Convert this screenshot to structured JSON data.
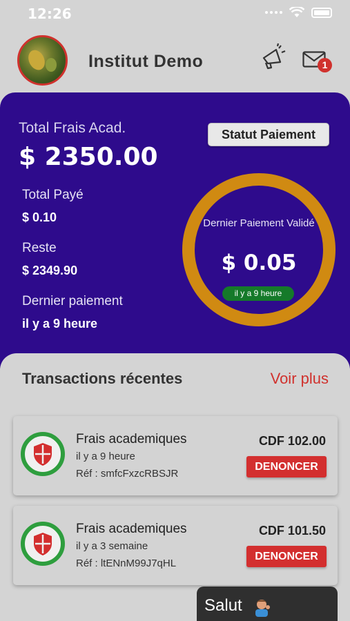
{
  "status_bar": {
    "time": "12:26"
  },
  "header": {
    "institution": "Institut Demo",
    "notification_count": "1",
    "icons": [
      "avatar",
      "megaphone-icon",
      "mail-icon"
    ]
  },
  "summary": {
    "total_label": "Total Frais Acad.",
    "total_value": "$ 2350.00",
    "paid_label": "Total Payé",
    "paid_value": "$ 0.10",
    "rest_label": "Reste",
    "rest_value": "$ 2349.90",
    "last_label": "Dernier paiement",
    "last_value": "il y a 9 heure",
    "status_button": "Statut Paiement",
    "ring_title": "Dernier Paiement Validé",
    "ring_value": "$ 0.05",
    "ring_badge": "il y a 9 heure"
  },
  "transactions": {
    "title": "Transactions récentes",
    "more": "Voir plus",
    "items": [
      {
        "name": "Frais academiques",
        "time": "il y a 9 heure",
        "ref": "Réf : smfcFxzcRBSJR",
        "amount": "CDF 102.00",
        "action": "DENONCER"
      },
      {
        "name": "Frais academiques",
        "time": "il y a 3 semaine",
        "ref": "Réf : ltENnM99J7qHL",
        "amount": "CDF 101.50",
        "action": "DENONCER"
      }
    ]
  },
  "chat": {
    "text": "Salut"
  },
  "colors": {
    "card_purple": "#2e0b8c",
    "ring_orange": "#d08a12",
    "accent_red": "#d32f2f",
    "badge_green": "#157a2a"
  }
}
